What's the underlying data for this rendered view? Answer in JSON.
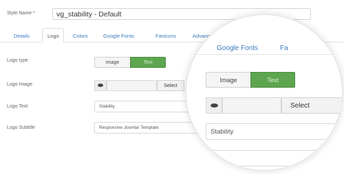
{
  "style_name": {
    "label": "Style Name *",
    "value": "vg_stability - Default"
  },
  "tabs": [
    {
      "label": "Details"
    },
    {
      "label": "Logo"
    },
    {
      "label": "Colors"
    },
    {
      "label": "Google Fonts"
    },
    {
      "label": "Favicons"
    },
    {
      "label": "Advanced"
    }
  ],
  "form": {
    "logo_type": {
      "label": "Logo type",
      "options": [
        "Image",
        "Text"
      ],
      "selected": "Text"
    },
    "logo_image": {
      "label": "Logo Image",
      "select_label": "Select"
    },
    "logo_text": {
      "label": "Logo Text",
      "value": "Stability"
    },
    "logo_subtitle": {
      "label": "Logo Subtitle",
      "value": "Responsive Joomla! Template"
    }
  },
  "magnifier": {
    "tab_google_fonts": "Google Fonts",
    "tab_partial": "Fa",
    "image_label": "Image",
    "text_label": "Text",
    "select_label": "Select",
    "logo_text_value": "Stability"
  },
  "colors": {
    "accent_green": "#5ea550",
    "link_blue": "#3a7bbf"
  },
  "icons": {
    "eye": "eye-icon"
  }
}
